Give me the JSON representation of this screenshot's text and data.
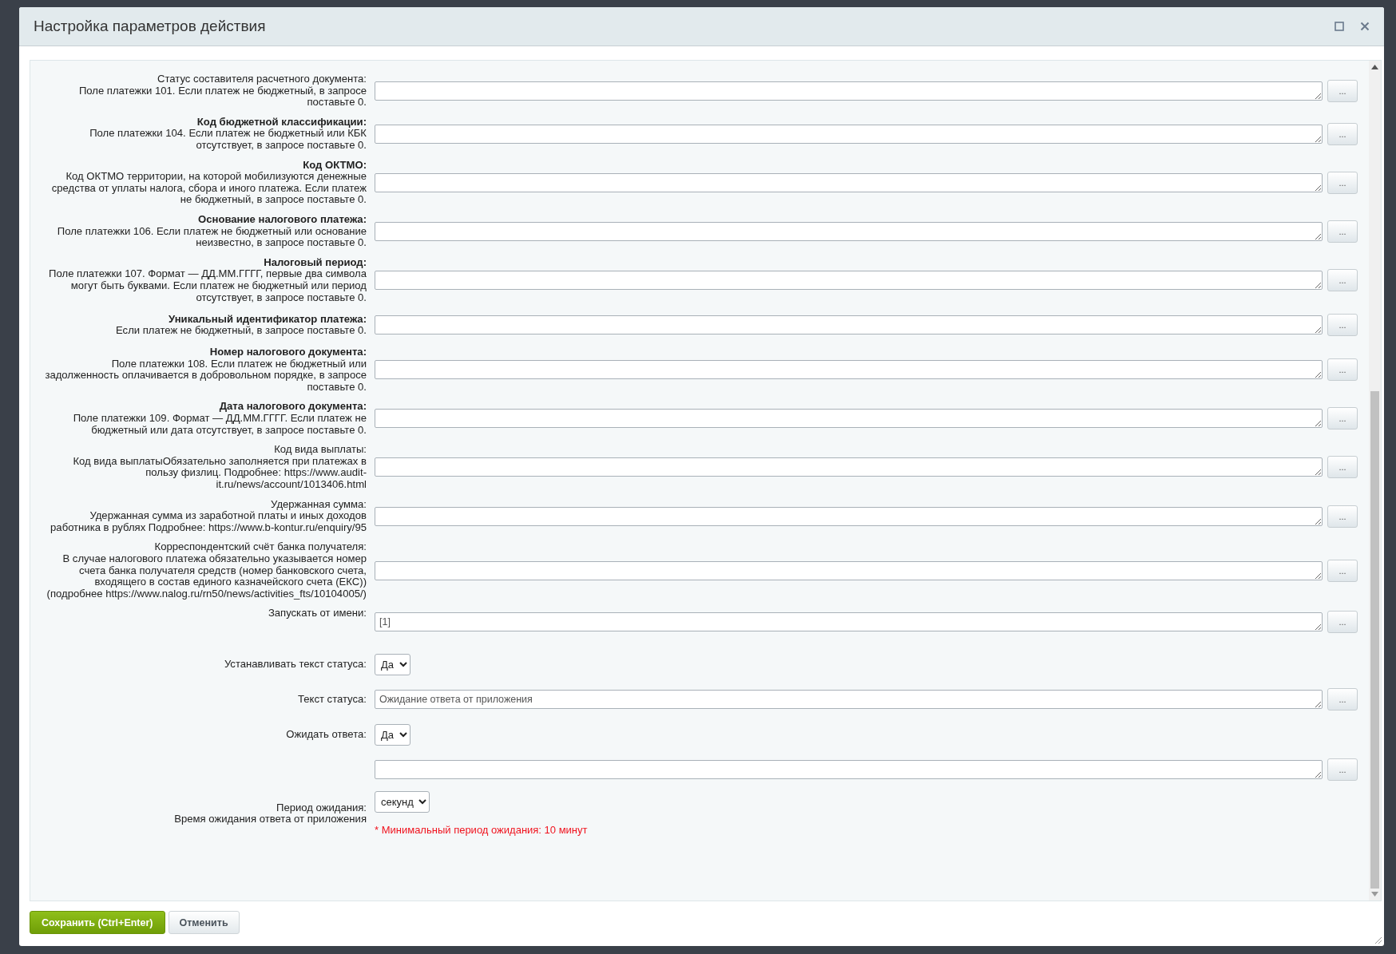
{
  "dialog": {
    "title": "Настройка параметров действия"
  },
  "fields": [
    {
      "kind": "textarea",
      "title": "Статус составителя расчетного документа:",
      "title_bold": false,
      "description": "Поле платежки 101. Если платеж не бюджетный, в запросе поставьте 0."
    },
    {
      "kind": "textarea",
      "title": "Код бюджетной классификации:",
      "title_bold": true,
      "description": "Поле платежки 104. Если платеж не бюджетный или КБК отсутствует, в запросе поставьте 0."
    },
    {
      "kind": "textarea",
      "title": "Код ОКТМО:",
      "title_bold": true,
      "description": "Код ОКТМО территории, на которой мобилизуются денежные средства от уплаты налога, сбора и иного платежа. Если платеж не бюджетный, в запросе поставьте 0."
    },
    {
      "kind": "textarea",
      "title": "Основание налогового платежа:",
      "title_bold": true,
      "description": "Поле платежки 106. Если платеж не бюджетный или основание неизвестно, в запросе поставьте 0."
    },
    {
      "kind": "textarea",
      "title": "Налоговый период:",
      "title_bold": true,
      "description": "Поле платежки 107. Формат — ДД.ММ.ГГГГ, первые два символа могут быть буквами. Если платеж не бюджетный или период отсутствует, в запросе поставьте 0."
    },
    {
      "kind": "textarea",
      "title": "Уникальный идентификатор платежа:",
      "title_bold": true,
      "description": "Если платеж не бюджетный, в запросе поставьте 0."
    },
    {
      "kind": "textarea",
      "title": "Номер налогового документа:",
      "title_bold": true,
      "description": "Поле платежки 108. Если платеж не бюджетный или задолженность оплачивается в добровольном порядке, в запросе поставьте 0."
    },
    {
      "kind": "textarea",
      "title": "Дата налогового документа:",
      "title_bold": true,
      "description": "Поле платежки 109. Формат — ДД.ММ.ГГГГ. Если платеж не бюджетный или дата отсутствует, в запросе поставьте 0."
    },
    {
      "kind": "textarea",
      "title": "Код вида выплаты:",
      "title_bold": false,
      "description": "Код вида выплатыОбязательно заполняется при платежах в пользу физлиц. Подробнее: https://www.audit-it.ru/news/account/1013406.html"
    },
    {
      "kind": "textarea",
      "title": "Удержанная сумма:",
      "title_bold": false,
      "description": "Удержанная сумма из заработной платы и иных доходов работника в рублях Подробнее: https://www.b-kontur.ru/enquiry/95"
    },
    {
      "kind": "textarea",
      "title": "Корреспондентский счёт банка получателя:",
      "title_bold": false,
      "description": "В случае налогового платежа обязательно указывается номер счета банка получателя средств (номер банковского счета, входящего в состав единого казначейского счета (ЕКС)) (подробнее https://www.nalog.ru/rn50/news/activities_fts/10104005/)"
    },
    {
      "kind": "textarea",
      "title": "Запускать от имени:",
      "title_bold": false,
      "value": "[1]",
      "label_top": true
    },
    {
      "kind": "select",
      "title": "Устанавливать текст статуса:",
      "title_bold": false,
      "value": "Да"
    },
    {
      "kind": "textarea",
      "title": "Текст статуса:",
      "title_bold": false,
      "value": "Ожидание ответа от приложения"
    },
    {
      "kind": "select",
      "title": "Ожидать ответа:",
      "title_bold": false,
      "value": "Да"
    },
    {
      "kind": "textarea"
    },
    {
      "kind": "select",
      "title": "Период ожидания:",
      "title_bold": false,
      "description": "Время ожидания ответа от приложения",
      "value": "секунд",
      "note": "* Минимальный период ожидания: 10 минут"
    }
  ],
  "more_button": "...",
  "buttons": [
    {
      "kind": "primary",
      "label": "Сохранить (Ctrl+Enter)"
    },
    {
      "kind": "secondary",
      "label": "Отменить"
    }
  ]
}
